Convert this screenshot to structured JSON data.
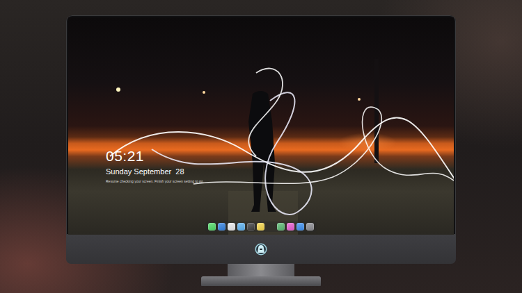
{
  "lock_screen": {
    "time": "05:21",
    "date": "Sunday September  28",
    "hint": "Resume checking your screen. Finish your screen setting to go."
  },
  "dock": {
    "items": [
      {
        "color": "#4cd964"
      },
      {
        "color": "#2f7fe0"
      },
      {
        "color": "#e8e8ea"
      },
      {
        "color": "#5ab0f0"
      },
      {
        "color": "#3a3a3c"
      },
      {
        "color": "#f5d547"
      },
      {
        "color": "#58b870"
      },
      {
        "color": "#e85ad0"
      },
      {
        "color": "#3a8ef0"
      },
      {
        "color": "#8a8a90"
      }
    ],
    "separator_after": 6
  }
}
